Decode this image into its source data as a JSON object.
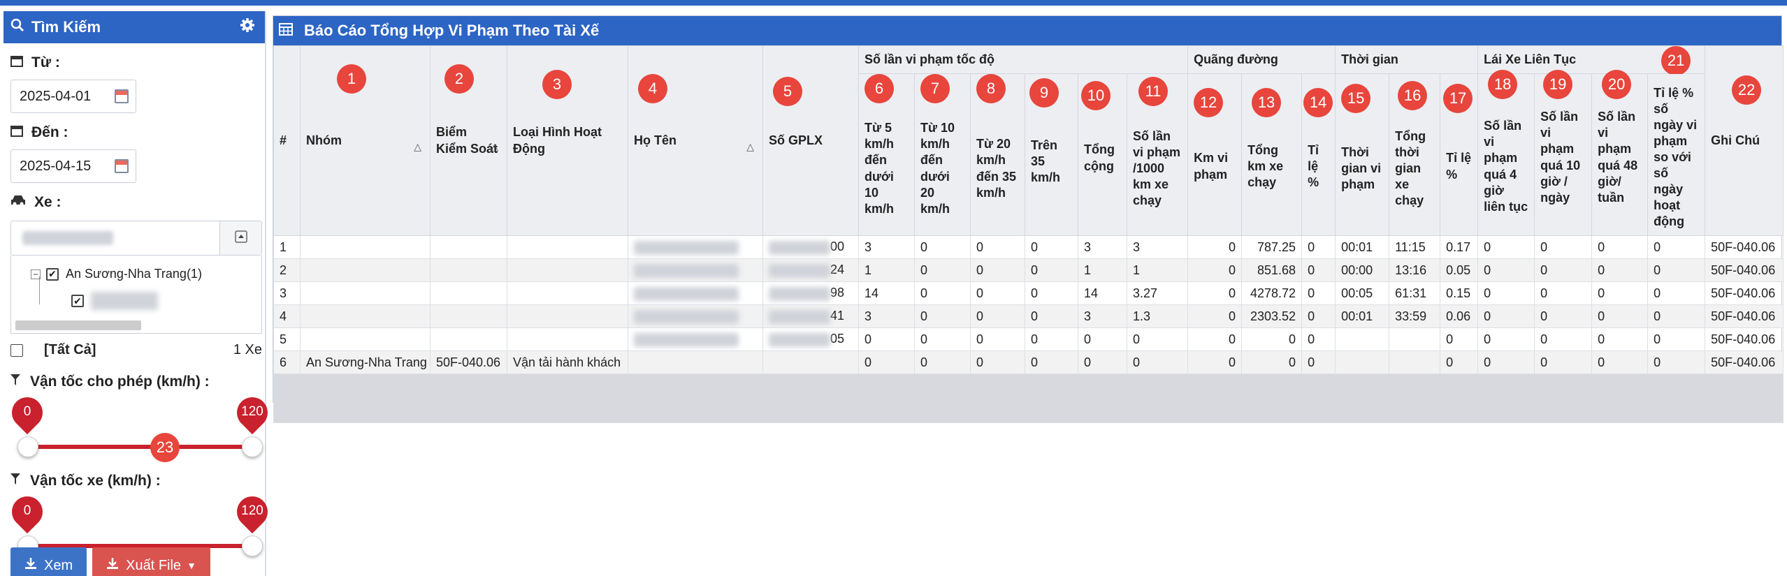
{
  "sidebar": {
    "title": "Tìm Kiếm",
    "from_label": "Từ :",
    "from_value": "2025-04-01",
    "to_label": "Đến :",
    "to_value": "2025-04-15",
    "vehicle_label": "Xe :",
    "tree_group": "An Sương-Nha Trang(1)",
    "select_all": "[Tất Cả]",
    "vehicle_count": "1 Xe",
    "speed_allowed_label": "Vận tốc cho phép (km/h) :",
    "speed_allowed_min": "0",
    "speed_allowed_max": "120",
    "speed_vehicle_label": "Vận tốc xe (km/h) :",
    "speed_vehicle_min": "0",
    "speed_vehicle_max": "120",
    "view_button": "Xem",
    "export_button": "Xuất File"
  },
  "main": {
    "title": "Báo Cáo Tổng Hợp Vi Phạm Theo Tài Xế",
    "group_headers": {
      "speed": "Số lần vi phạm tốc độ",
      "distance": "Quãng đường",
      "time": "Thời gian",
      "continuous": "Lái Xe Liên Tục"
    },
    "columns": {
      "idx": "#",
      "group": "Nhóm",
      "plate": "Biểm Kiểm Soát",
      "type": "Loại Hình Hoạt Động",
      "name": "Họ Tên",
      "license": "Số GPLX",
      "s5": "Từ 5 km/h đến dưới 10 km/h",
      "s10": "Từ 10 km/h đến dưới 20 km/h",
      "s20": "Từ 20 km/h đến 35 km/h",
      "s35": "Trên 35 km/h",
      "stotal": "Tổng cộng",
      "s1000": "Số lần vi phạm /1000 km xe chạy",
      "kmv": "Km vi phạm",
      "kmt": "Tổng km xe chạy",
      "kmr": "Tỉ lệ %",
      "tv": "Thời gian vi phạm",
      "tt": "Tổng thời gian xe chạy",
      "tr": "Tỉ lệ %",
      "c4": "Số lần vi phạm quá 4 giờ liên tục",
      "c10": "Số lần vi phạm quá 10 giờ / ngày",
      "c48": "Số lần vi phạm quá 48 giờ/ tuần",
      "cr": "Tỉ lệ % số ngày vi phạm so với số ngày hoạt động",
      "note": "Ghi Chú"
    },
    "rows": [
      {
        "idx": "1",
        "group": "",
        "plate": "",
        "type": "",
        "name": "",
        "license": "00",
        "s5": "3",
        "s10": "0",
        "s20": "0",
        "s35": "0",
        "stotal": "3",
        "s1000": "3",
        "kmv": "0",
        "kmt": "787.25",
        "kmr": "0",
        "tv": "00:01",
        "tt": "11:15",
        "tr": "0.17",
        "c4": "0",
        "c10": "0",
        "c48": "0",
        "cr": "0",
        "note": "50F-040.06"
      },
      {
        "idx": "2",
        "group": "",
        "plate": "",
        "type": "",
        "name": "",
        "license": "24",
        "s5": "1",
        "s10": "0",
        "s20": "0",
        "s35": "0",
        "stotal": "1",
        "s1000": "1",
        "kmv": "0",
        "kmt": "851.68",
        "kmr": "0",
        "tv": "00:00",
        "tt": "13:16",
        "tr": "0.05",
        "c4": "0",
        "c10": "0",
        "c48": "0",
        "cr": "0",
        "note": "50F-040.06"
      },
      {
        "idx": "3",
        "group": "",
        "plate": "",
        "type": "",
        "name": "",
        "license": "98",
        "s5": "14",
        "s10": "0",
        "s20": "0",
        "s35": "0",
        "stotal": "14",
        "s1000": "3.27",
        "kmv": "0",
        "kmt": "4278.72",
        "kmr": "0",
        "tv": "00:05",
        "tt": "61:31",
        "tr": "0.15",
        "c4": "0",
        "c10": "0",
        "c48": "0",
        "cr": "0",
        "note": "50F-040.06"
      },
      {
        "idx": "4",
        "group": "",
        "plate": "",
        "type": "",
        "name": "",
        "license": "41",
        "s5": "3",
        "s10": "0",
        "s20": "0",
        "s35": "0",
        "stotal": "3",
        "s1000": "1.3",
        "kmv": "0",
        "kmt": "2303.52",
        "kmr": "0",
        "tv": "00:01",
        "tt": "33:59",
        "tr": "0.06",
        "c4": "0",
        "c10": "0",
        "c48": "0",
        "cr": "0",
        "note": "50F-040.06"
      },
      {
        "idx": "5",
        "group": "",
        "plate": "",
        "type": "",
        "name": "",
        "license": "05",
        "s5": "0",
        "s10": "0",
        "s20": "0",
        "s35": "0",
        "stotal": "0",
        "s1000": "0",
        "kmv": "0",
        "kmt": "0",
        "kmr": "0",
        "tv": "",
        "tt": "",
        "tr": "0",
        "c4": "0",
        "c10": "0",
        "c48": "0",
        "cr": "0",
        "note": "50F-040.06"
      },
      {
        "idx": "6",
        "group": "An Sương-Nha Trang",
        "plate": "50F-040.06",
        "type": "Vận tải hành khách",
        "name": "",
        "license": "",
        "s5": "0",
        "s10": "0",
        "s20": "0",
        "s35": "0",
        "stotal": "0",
        "s1000": "0",
        "kmv": "0",
        "kmt": "0",
        "kmr": "0",
        "tv": "",
        "tt": "",
        "tr": "0",
        "c4": "0",
        "c10": "0",
        "c48": "0",
        "cr": "0",
        "note": "50F-040.06"
      }
    ]
  },
  "markers": [
    "1",
    "2",
    "3",
    "4",
    "5",
    "6",
    "7",
    "8",
    "9",
    "10",
    "11",
    "12",
    "13",
    "14",
    "15",
    "16",
    "17",
    "18",
    "19",
    "20",
    "21",
    "22",
    "23"
  ],
  "colors": {
    "header_blue": "#2d65c4",
    "marker_red": "#e8453c",
    "slider_red": "#c9212d",
    "export_red": "#d9534f"
  }
}
